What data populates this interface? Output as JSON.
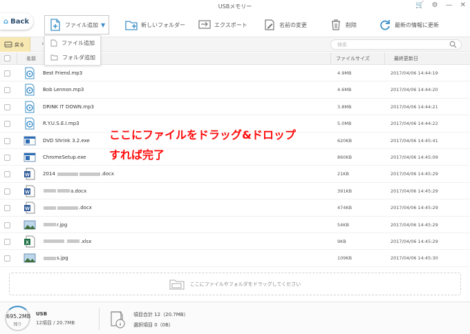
{
  "window": {
    "title": "USBメモリー"
  },
  "nav": {
    "back_label": "Back",
    "modoru_label": "戻る"
  },
  "toolbar": {
    "add_file": "ファイル追加",
    "new_folder": "新しいフォルダー",
    "export": "エクスポート",
    "rename": "名前の変更",
    "delete": "削除",
    "refresh": "最新の情報に更新"
  },
  "dropdown": {
    "items": [
      "ファイル追加",
      "フォルダ追加"
    ]
  },
  "search": {
    "placeholder": "検索"
  },
  "table": {
    "headers": {
      "name": "名前",
      "size": "ファイルサイズ",
      "date": "最終更新日"
    },
    "rows": [
      {
        "type": "music",
        "name": "Best Friend.mp3",
        "size": "4.9MB",
        "date": "2017/04/06 14:44:19"
      },
      {
        "type": "music",
        "name": "Bob Lennon.mp3",
        "size": "4.6MB",
        "date": "2017/04/06 14:44:20"
      },
      {
        "type": "music",
        "name": "DRINK IT DOWN.mp3",
        "size": "3.8MB",
        "date": "2017/04/06 14:44:21"
      },
      {
        "type": "music",
        "name": "R.Y.U.S.E.I.mp3",
        "size": "5.0MB",
        "date": "2017/04/06 14:44:22"
      },
      {
        "type": "exe",
        "name": "DVD Shrink 3.2.exe",
        "size": "620KB",
        "date": "2017/04/06 14:45:41"
      },
      {
        "type": "exe",
        "name": "ChromeSetup.exe",
        "size": "860KB",
        "date": "2017/04/06 14:45:09"
      },
      {
        "type": "word",
        "name_pre": "2014",
        "name_post": ".docx",
        "size": "21KB",
        "date": "2017/04/06 14:45:29"
      },
      {
        "type": "word",
        "name_pre": "",
        "name_post": "a.docx",
        "size": "391KB",
        "date": "2017/04/06 14:45:29"
      },
      {
        "type": "word",
        "name_pre": "",
        "name_post": ".docx",
        "size": "474KB",
        "date": "2017/04/06 14:45:29"
      },
      {
        "type": "image",
        "name_pre": "",
        "name_post": "r.jpg",
        "size": "54KB",
        "date": "2017/04/06 14:45:29"
      },
      {
        "type": "excel",
        "name_pre": "",
        "name_post": ".xlsx",
        "size": "9KB",
        "date": "2017/04/06 14:45:29"
      },
      {
        "type": "image",
        "name_pre": "",
        "name_post": "s.jpg",
        "size": "109KB",
        "date": "2017/04/06 14:45:30"
      }
    ]
  },
  "annotation": {
    "line1": "ここにファイルをドラッグ&ドロップ",
    "line2": "すれば完了"
  },
  "dropzone": {
    "text": "ここにファイルやフォルダをドラッグしてください"
  },
  "status": {
    "free": "695.2MB",
    "free_label": "残り",
    "device": "USB",
    "device_sub": "12項目 / 20.7MB",
    "total": "項目合計 12（20.7MB）",
    "selected": "選択項目 0（0B）"
  },
  "colors": {
    "accent": "#3d8fc7",
    "annotation": "#ff0a0a",
    "modoru_bg": "#f7e7b0"
  }
}
